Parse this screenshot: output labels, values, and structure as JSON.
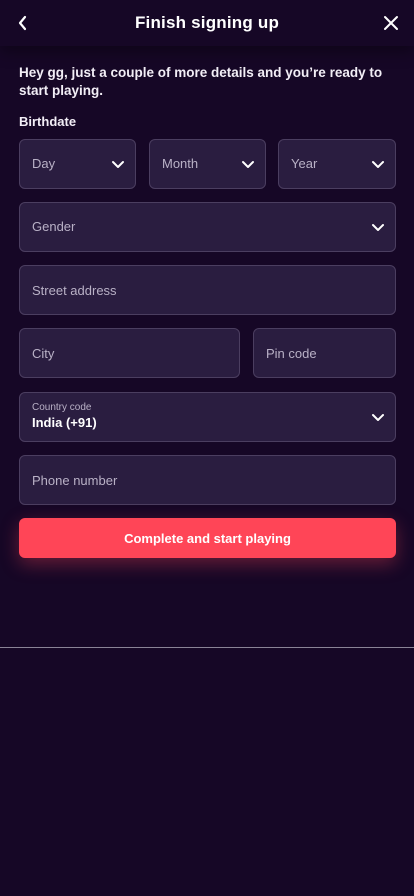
{
  "header": {
    "title": "Finish signing up"
  },
  "intro": {
    "text": "Hey gg, just a couple of more details and you’re ready to start playing."
  },
  "birthdate": {
    "label": "Birthdate",
    "day_placeholder": "Day",
    "month_placeholder": "Month",
    "year_placeholder": "Year"
  },
  "gender": {
    "placeholder": "Gender"
  },
  "address": {
    "street_placeholder": "Street address",
    "city_placeholder": "City",
    "pin_placeholder": "Pin code"
  },
  "country": {
    "label": "Country code",
    "value": "India (+91)"
  },
  "phone": {
    "placeholder": "Phone number"
  },
  "cta": {
    "label": "Complete and start playing"
  },
  "icons": {
    "back": "chevron-left-icon",
    "close": "close-icon",
    "dropdown": "chevron-down-icon"
  },
  "colors": {
    "background": "#160726",
    "field": "#2a1d40",
    "accent": "#ff4557"
  }
}
